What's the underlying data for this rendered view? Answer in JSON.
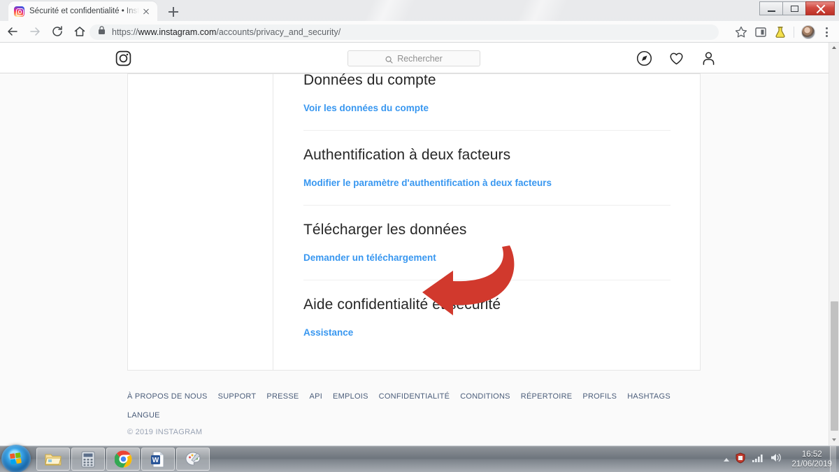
{
  "browser": {
    "tab_title": "Sécurité et confidentialité • Insta",
    "favicon": "instagram-favicon",
    "new_tab_label": "+",
    "url_protocol": "https://",
    "url_host": "www.instagram.com",
    "url_path": "/accounts/privacy_and_security/",
    "lock_icon": "lock-icon",
    "back_icon": "back-arrow-icon",
    "forward_icon": "forward-arrow-icon",
    "reload_icon": "reload-icon",
    "home_icon": "home-icon",
    "bookmark_icon": "star-icon",
    "extension_icon": "reading-list-icon",
    "flask_icon": "flask-icon",
    "profile_icon": "profile-avatar-icon",
    "menu_icon": "kebab-menu-icon",
    "window_minimize": "minimize-icon",
    "window_maximize": "maximize-icon",
    "window_close": "close-icon"
  },
  "instagram": {
    "logo": "instagram-camera-logo",
    "search": {
      "placeholder": "Rechercher",
      "icon": "search-icon",
      "value": ""
    },
    "nav_actions": [
      {
        "name": "explore",
        "icon": "compass-icon"
      },
      {
        "name": "activity",
        "icon": "heart-icon"
      },
      {
        "name": "profile",
        "icon": "person-icon"
      }
    ],
    "settings_sections": [
      {
        "heading": "Données du compte",
        "link": "Voir les données du compte",
        "divider": true
      },
      {
        "heading": "Authentification à deux facteurs",
        "link": "Modifier le paramètre d'authentification à deux facteurs",
        "divider": true
      },
      {
        "heading": "Télécharger les données",
        "link": "Demander un téléchargement",
        "divider": true
      },
      {
        "heading": "Aide confidentialité et sécurité",
        "link": "Assistance",
        "divider": false
      }
    ],
    "footer_links": [
      "À PROPOS DE NOUS",
      "SUPPORT",
      "PRESSE",
      "API",
      "EMPLOIS",
      "CONFIDENTIALITÉ",
      "CONDITIONS",
      "RÉPERTOIRE",
      "PROFILS",
      "HASHTAGS",
      "LANGUE"
    ],
    "footer_copyright": "© 2019 INSTAGRAM"
  },
  "annotation": {
    "type": "red-curved-arrow",
    "color": "#d1392d",
    "points_to": "Demander un téléchargement"
  },
  "colors": {
    "link": "#3897f0",
    "heading": "#262626",
    "page_bg": "#fafafa",
    "annotation_red": "#d1392d"
  },
  "taskbar": {
    "start_label": "start-orb",
    "items": [
      {
        "name": "file-explorer",
        "icon": "folder-icon"
      },
      {
        "name": "calculator",
        "icon": "calculator-icon"
      },
      {
        "name": "google-chrome",
        "icon": "chrome-icon"
      },
      {
        "name": "microsoft-word",
        "icon": "word-icon"
      },
      {
        "name": "paint",
        "icon": "paint-palette-icon"
      }
    ],
    "tray": {
      "show_hidden_icons": "chevron-up-icon",
      "antivirus_icon": "shield-icon",
      "network_icon": "network-signal-icon",
      "volume_icon": "speaker-icon",
      "time": "16:52",
      "date": "21/06/2019"
    }
  }
}
